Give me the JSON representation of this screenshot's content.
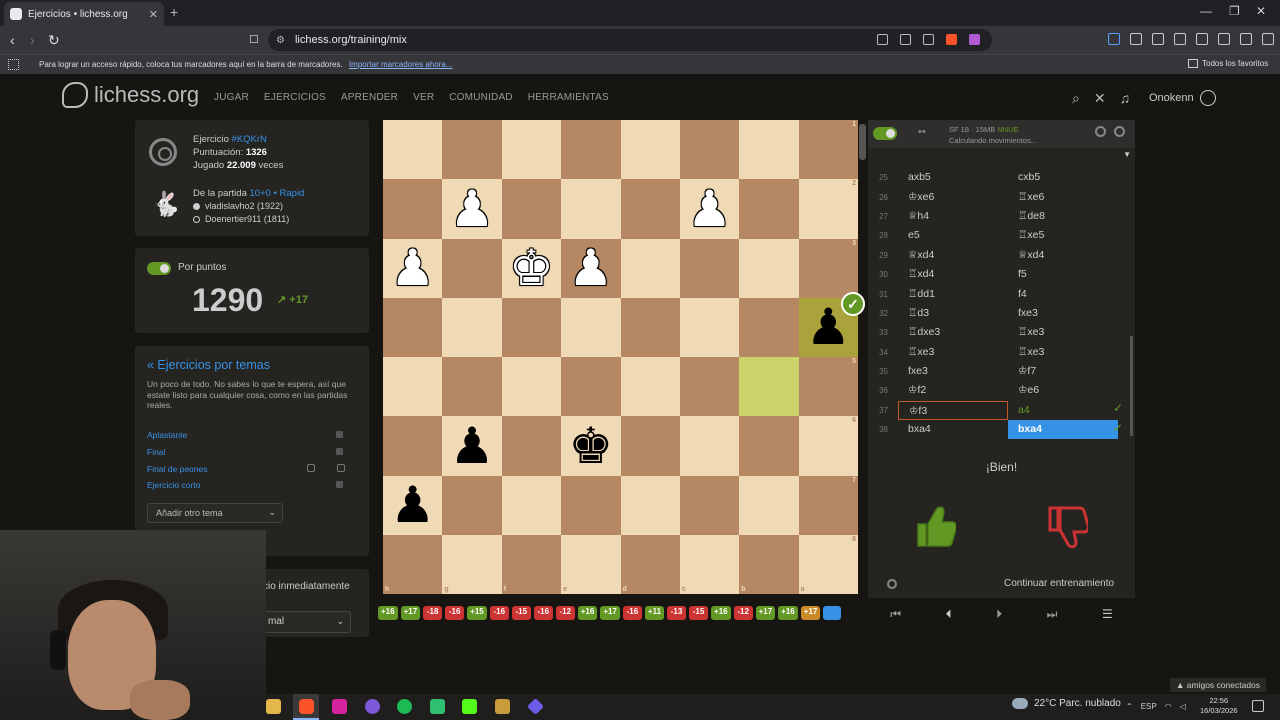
{
  "browser": {
    "tab_title": "Ejercicios • lichess.org",
    "url": "lichess.org/training/mix",
    "bookmark_hint": "Para lograr un acceso rápido, coloca tus marcadores aquí en la barra de marcadores.",
    "bookmark_import": "Importar marcadores ahora...",
    "all_favorites": "Todos los favoritos"
  },
  "site": {
    "logo": "lichess.org",
    "nav": [
      "JUGAR",
      "EJERCICIOS",
      "APRENDER",
      "VER",
      "COMUNIDAD",
      "HERRAMIENTAS"
    ],
    "username": "Onokenn"
  },
  "puzzle": {
    "label": "Ejercicio",
    "id": "#KQKrN",
    "rating_label": "Puntuación:",
    "rating": "1326",
    "played_label": "Jugado",
    "played_count": "22.009",
    "played_suffix": "veces",
    "game_label": "De la partida",
    "game_type": "10+0 • Rapid",
    "white_player": "vladislavho2 (1922)",
    "black_player": "Doenertier911 (1811)"
  },
  "user_rating": {
    "label": "Por puntos",
    "value": "1290",
    "delta": "+17"
  },
  "themes": {
    "title": "« Ejercicios por temas",
    "description": "Un poco de todo. No sabes lo que te espera, así que estate listo para cualquier cosa, como en las partidas reales.",
    "items": [
      "Aplastante",
      "Final",
      "Final de peones",
      "Ejercicio corto"
    ],
    "add_theme": "Añadir otro tema"
  },
  "next_puzzle": {
    "label": "cio inmediatamente",
    "select_value": "mal"
  },
  "board": {
    "ranks": [
      "1",
      "2",
      "3",
      "4",
      "5",
      "6",
      "7",
      "8"
    ],
    "files": [
      "h",
      "g",
      "f",
      "e",
      "d",
      "c",
      "b",
      "a"
    ]
  },
  "history": [
    "+16",
    "+17",
    "-18",
    "-16",
    "+15",
    "-16",
    "-15",
    "-16",
    "-12",
    "+16",
    "+17",
    "-16",
    "+11",
    "-13",
    "-15",
    "+16",
    "-12",
    "+17",
    "+16",
    "+17"
  ],
  "engine": {
    "name": "SF 18 · 15MB",
    "nnue": "NNUE",
    "status": "Calculando movimientos..."
  },
  "moves": [
    {
      "num": "25",
      "white": "axb5",
      "black": "cxb5"
    },
    {
      "num": "26",
      "white": "♔xe6",
      "black": "♖xe6"
    },
    {
      "num": "27",
      "white": "♕h4",
      "black": "♖de8"
    },
    {
      "num": "28",
      "white": "e5",
      "black": "♖xe5"
    },
    {
      "num": "29",
      "white": "♕xd4",
      "black": "♕xd4"
    },
    {
      "num": "30",
      "white": "♖xd4",
      "black": "f5"
    },
    {
      "num": "31",
      "white": "♖dd1",
      "black": "f4"
    },
    {
      "num": "32",
      "white": "♖d3",
      "black": "fxe3"
    },
    {
      "num": "33",
      "white": "♖dxe3",
      "black": "♖xe3"
    },
    {
      "num": "34",
      "white": "♖xe3",
      "black": "♖xe3"
    },
    {
      "num": "35",
      "white": "fxe3",
      "black": "♔f7"
    },
    {
      "num": "36",
      "white": "♔f2",
      "black": "♔e6"
    },
    {
      "num": "37",
      "white": "♔f3",
      "black": "a4"
    },
    {
      "num": "38",
      "white": "bxa4",
      "black": "bxa4"
    }
  ],
  "feedback": {
    "message": "¡Bien!",
    "continue": "Continuar entrenamiento"
  },
  "taskbar": {
    "friends": "amigos conectados",
    "weather": "22°C  Parc. nublado",
    "lang": "ESP",
    "time": "22:56",
    "date": "16/03/2026"
  },
  "colors": {
    "accent": "#3692e7",
    "good": "#629924",
    "bad": "#cc3333",
    "board_light": "#f0d9b5",
    "board_dark": "#b58863"
  }
}
